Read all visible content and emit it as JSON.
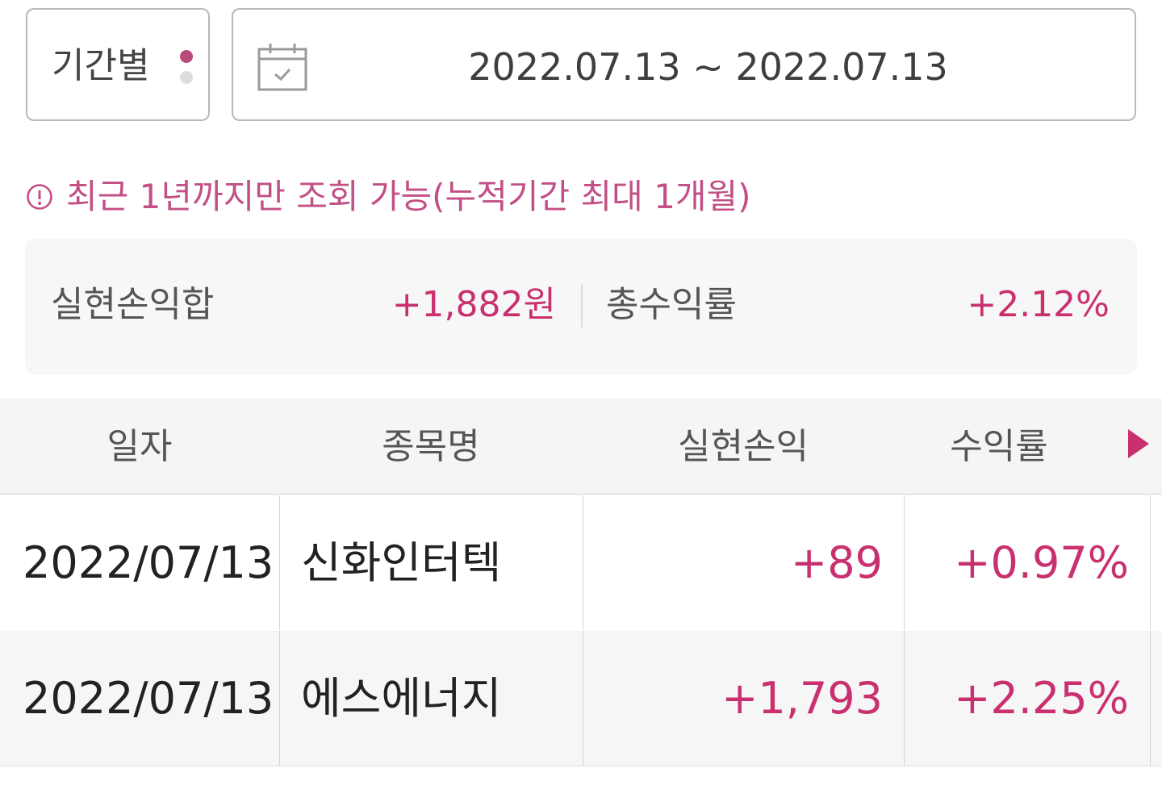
{
  "colors": {
    "accent": "#c9306f",
    "notice": "#c24f86",
    "dot_active": "#b84978",
    "dot_inactive": "#dddddd",
    "icon_gray": "#9a9a9a"
  },
  "filter": {
    "period_label": "기간별",
    "date_range": "2022.07.13 ~ 2022.07.13",
    "calendar_icon": "calendar-check-icon"
  },
  "notice": {
    "icon": "exclamation-circle-icon",
    "text": "최근 1년까지만 조회 가능(누적기간 최대 1개월)"
  },
  "summary": {
    "realized_total_label": "실현손익합",
    "realized_total_value": "+1,882원",
    "total_return_label": "총수익률",
    "total_return_value": "+2.12%"
  },
  "table": {
    "headers": [
      "일자",
      "종목명",
      "실현손익",
      "수익률"
    ],
    "scroll_icon": "triangle-right-icon",
    "rows": [
      {
        "date": "2022/07/13",
        "name": "신화인터텍",
        "pnl": "+89",
        "rate": "+0.97%"
      },
      {
        "date": "2022/07/13",
        "name": "에스에너지",
        "pnl": "+1,793",
        "rate": "+2.25%"
      }
    ]
  }
}
